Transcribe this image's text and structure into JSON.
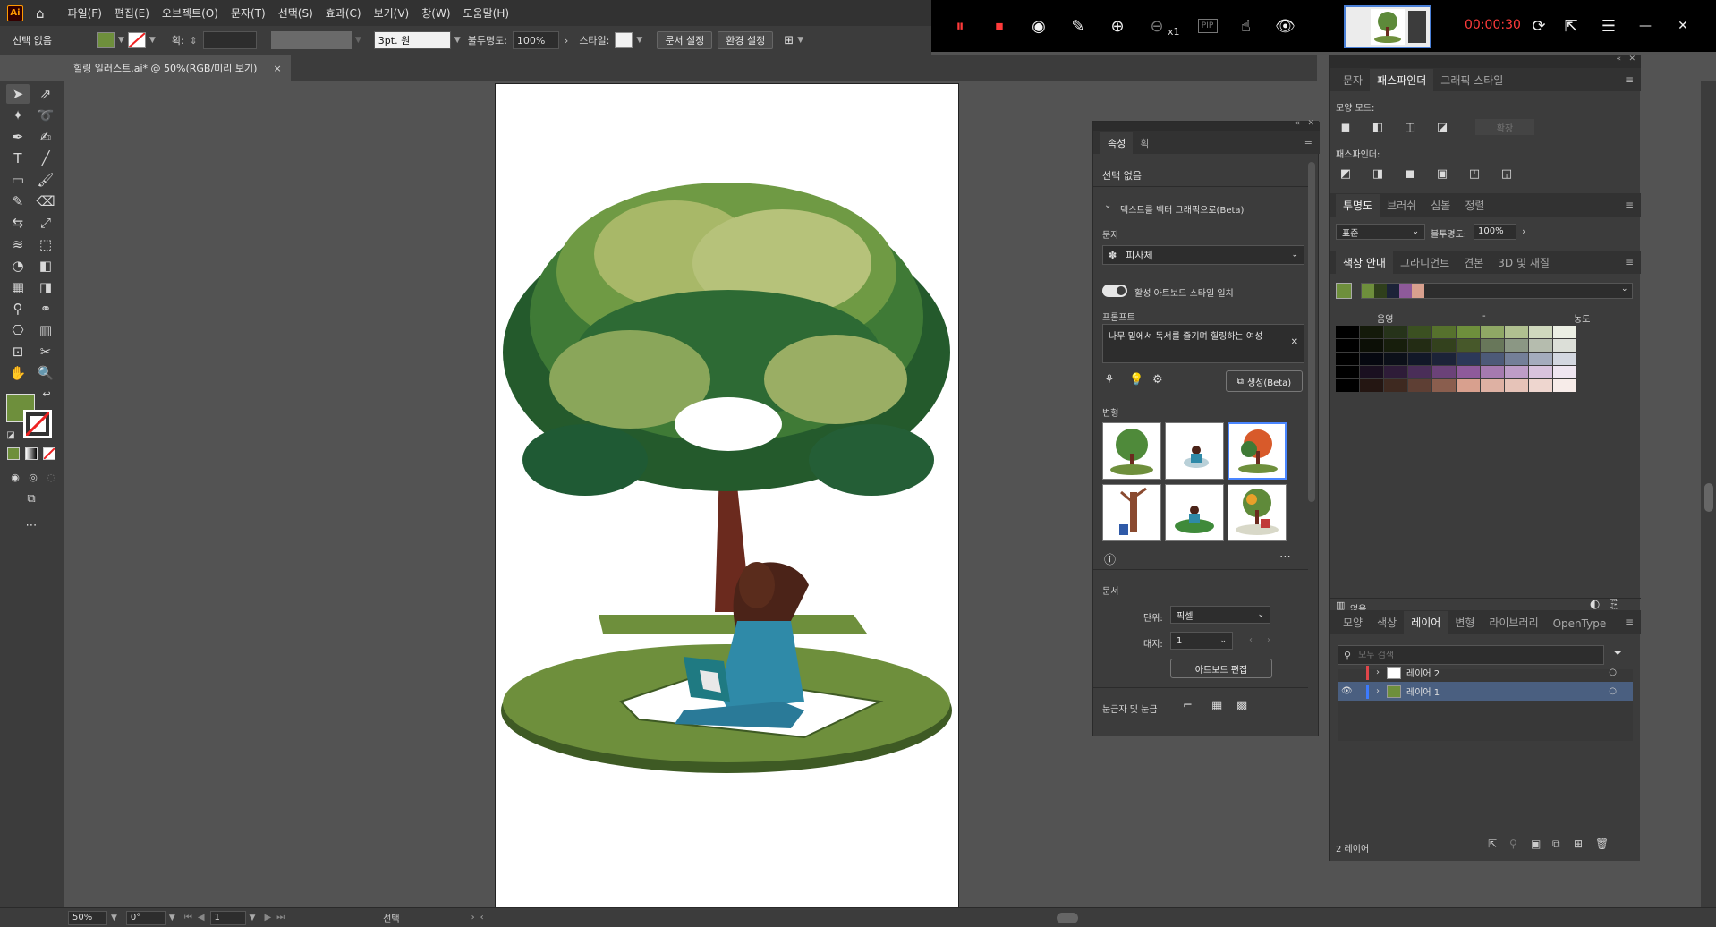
{
  "menubar": {
    "app_logo": "Ai",
    "items": [
      "파일(F)",
      "편집(E)",
      "오브젝트(O)",
      "문자(T)",
      "선택(S)",
      "효과(C)",
      "보기(V)",
      "창(W)",
      "도움말(H)"
    ]
  },
  "recorder": {
    "time": "00:00:30",
    "zoom_label": "x1",
    "pip_label": "PIP"
  },
  "controlbar": {
    "selection": "선택 없음",
    "stroke_label": "획:",
    "brush": "3pt. 원",
    "opacity_label": "불투명도:",
    "opacity_value": "100%",
    "style_label": "스타일:",
    "doc_setup": "문서 설정",
    "prefs": "환경 설정",
    "fill_color": "#6e8f3c"
  },
  "doctab": {
    "title": "힐링 일러스트.ai* @ 50%(RGB/미리 보기)",
    "close": "×"
  },
  "properties": {
    "tabs": [
      "속성",
      "획"
    ],
    "selection": "선택 없음",
    "text_to_vector": "텍스트를 벡터 그래픽으로(Beta)",
    "type_label": "문자",
    "type_value": "피사체",
    "toggle_label": "활성 아트보드 스타일 일치",
    "prompt_label": "프롬프트",
    "prompt_value": "나무 밑에서 독서를 즐기며 힐링하는 여성",
    "generate": "생성(Beta)",
    "variations_label": "변형",
    "document_label": "문서",
    "units_label": "단위:",
    "units_value": "픽셀",
    "artboard_label": "대지:",
    "artboard_value": "1",
    "edit_artboard": "아트보드 편집",
    "rulers_label": "눈금자 및 눈금"
  },
  "pathfinder": {
    "tabs": [
      "문자",
      "패스파인더",
      "그래픽 스타일"
    ],
    "shape_modes_label": "모양 모드:",
    "expand": "확장",
    "pathfinders_label": "패스파인더:"
  },
  "transparency": {
    "tabs": [
      "투명도",
      "브러쉬",
      "심볼",
      "정렬"
    ],
    "blend_mode": "표준",
    "opacity_label": "불투명도:",
    "opacity_value": "100%"
  },
  "color_guide": {
    "tabs": [
      "색상 안내",
      "그라디언트",
      "견본",
      "3D 및 재질"
    ],
    "shade_label": "음영",
    "dash": "-",
    "tint_label": "농도",
    "footer_label": "없음",
    "base_colors": [
      "#6e8f3c",
      "#2f3f1c",
      "#1c2338",
      "#8e5a9a",
      "#d8a08e"
    ],
    "grid": [
      [
        "#000000",
        "#141a0a",
        "#26331a",
        "#3b5021",
        "#56712d",
        "#6e8f3c",
        "#8fa865",
        "#b0c090",
        "#cfd8bd",
        "#ecefe4"
      ],
      [
        "#000000",
        "#0c0f06",
        "#171e0c",
        "#232c14",
        "#33411d",
        "#47582a",
        "#68775a",
        "#8b9784",
        "#b5bcae",
        "#dcdfd8"
      ],
      [
        "#000000",
        "#060810",
        "#0c1019",
        "#121828",
        "#1c2338",
        "#2c3858",
        "#4d5a78",
        "#747f98",
        "#a4acbd",
        "#d3d7e0"
      ],
      [
        "#000000",
        "#1a1020",
        "#2e1c38",
        "#4a2e58",
        "#6b4278",
        "#8e5a9a",
        "#a57aaf",
        "#be9dc7",
        "#d8c3dd",
        "#efe6f1"
      ],
      [
        "#000000",
        "#241612",
        "#3e2920",
        "#5e3f34",
        "#8a5e4e",
        "#d8a08e",
        "#deb1a3",
        "#e6c3b8",
        "#eed6cf",
        "#f7ece9"
      ]
    ]
  },
  "layers": {
    "tabs": [
      "모양",
      "색상",
      "레이어",
      "변형",
      "라이브러리",
      "OpenType"
    ],
    "search_placeholder": "모두 검색",
    "rows": [
      {
        "name": "레이어 2",
        "color": "#e0464a",
        "selected": false
      },
      {
        "name": "레이어 1",
        "color": "#3c7bff",
        "selected": true
      }
    ],
    "count": "2 레이어"
  },
  "statusbar": {
    "zoom": "50%",
    "rotation": "0°",
    "page": "1",
    "mode": "선택"
  }
}
